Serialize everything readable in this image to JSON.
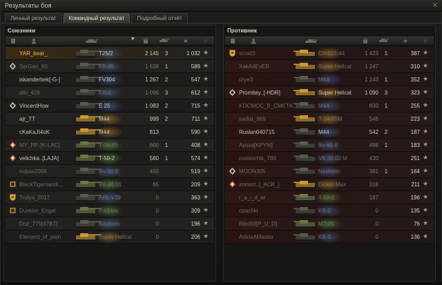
{
  "window": {
    "title": "Результаты боя",
    "close_glyph": "✕"
  },
  "tabs": [
    {
      "label": "Личный результат",
      "active": false
    },
    {
      "label": "Командный результат",
      "active": true
    },
    {
      "label": "Подробный отчёт",
      "active": false
    }
  ],
  "allies": {
    "title": "Союзники",
    "rows": [
      {
        "name": "YAR_bear_",
        "vehicle": "T25/2",
        "damage": "2 145",
        "kills": "3",
        "xp": "1 032",
        "self": true,
        "dead": false,
        "badge": "none",
        "vehicle_class": "blue"
      },
      {
        "name": "SerGan_80",
        "vehicle": "KB-85",
        "damage": "1 638",
        "kills": "1",
        "xp": "589",
        "self": false,
        "dead": true,
        "badge": "clan",
        "vehicle_class": "blue"
      },
      {
        "name": "iskanderbek[-G-]",
        "vehicle": "FV304",
        "damage": "1 267",
        "kills": "2",
        "xp": "547",
        "self": false,
        "dead": false,
        "badge": "none",
        "vehicle_class": "blue"
      },
      {
        "name": "diki_428",
        "vehicle": "KB-2",
        "damage": "1 096",
        "kills": "3",
        "xp": "612",
        "self": false,
        "dead": true,
        "badge": "none",
        "vehicle_class": "blue"
      },
      {
        "name": "VincentHow",
        "vehicle": "E 25",
        "damage": "1 083",
        "kills": "2",
        "xp": "715",
        "self": false,
        "dead": false,
        "badge": "clan",
        "vehicle_class": "blue"
      },
      {
        "name": "ajr_TT",
        "vehicle": "M44",
        "damage": "999",
        "kills": "2",
        "xp": "711",
        "self": false,
        "dead": false,
        "badge": "none",
        "vehicle_class": "gold"
      },
      {
        "name": "cKaKaJI4oK",
        "vehicle": "M44",
        "damage": "813",
        "kills": "",
        "xp": "590",
        "self": false,
        "dead": false,
        "badge": "none",
        "vehicle_class": "gold"
      },
      {
        "name": "MY_PP..[K-LAC]",
        "vehicle": "T-34-85",
        "damage": "600",
        "kills": "1",
        "xp": "408",
        "self": false,
        "dead": true,
        "badge": "rank",
        "vehicle_class": "green"
      },
      {
        "name": "velichka..[LAJA]",
        "vehicle": "T-50-2",
        "damage": "580",
        "kills": "1",
        "xp": "574",
        "self": false,
        "dead": false,
        "badge": "rank",
        "vehicle_class": "green"
      },
      {
        "name": "nubas2009",
        "vehicle": "Ikv 90 B",
        "damage": "450",
        "kills": "",
        "xp": "519",
        "self": false,
        "dead": true,
        "badge": "none",
        "vehicle_class": "blue"
      },
      {
        "name": "BlackTigemandi...",
        "vehicle": "VK 28.01",
        "damage": "65",
        "kills": "",
        "xp": "209",
        "self": false,
        "dead": true,
        "badge": "clan2",
        "vehicle_class": "green"
      },
      {
        "name": "Trulya_2017",
        "vehicle": "ARL V39",
        "damage": "0",
        "kills": "",
        "xp": "363",
        "self": false,
        "dead": true,
        "badge": "shield",
        "vehicle_class": "blue"
      },
      {
        "name": "Dunkler_Engel",
        "vehicle": "P.43 bis",
        "damage": "0",
        "kills": "",
        "xp": "309",
        "self": false,
        "dead": true,
        "badge": "clan2",
        "vehicle_class": "green"
      },
      {
        "name": "Doz_775[47BT]",
        "vehicle": "Nashorn",
        "damage": "0",
        "kills": "",
        "xp": "196",
        "self": false,
        "dead": true,
        "badge": "none",
        "vehicle_class": "blue"
      },
      {
        "name": "Element_of_pain",
        "vehicle": "Super Hellcat",
        "damage": "0",
        "kills": "",
        "xp": "206",
        "self": false,
        "dead": true,
        "badge": "none",
        "vehicle_class": "gold"
      }
    ]
  },
  "enemies": {
    "title": "Противник",
    "rows": [
      {
        "name": "scratt3",
        "vehicle": "СУ-122-44",
        "damage": "1 423",
        "kills": "1",
        "xp": "387",
        "dead": true,
        "badge": "shield",
        "vehicle_class": "gold"
      },
      {
        "name": "XakA4EvER",
        "vehicle": "Super Hellcat",
        "damage": "1 247",
        "kills": "",
        "xp": "310",
        "dead": true,
        "badge": "none",
        "vehicle_class": "gold"
      },
      {
        "name": "orye3",
        "vehicle": "M44",
        "damage": "1 143",
        "kills": "1",
        "xp": "352",
        "dead": true,
        "badge": "none",
        "vehicle_class": "blue"
      },
      {
        "name": "Promitey..[-HDR]",
        "vehicle": "Super Hellcat",
        "damage": "1 090",
        "kills": "3",
        "xp": "323",
        "dead": false,
        "badge": "clan",
        "vehicle_class": "gold"
      },
      {
        "name": "KOCMOC_B_CMETA..",
        "vehicle": "M44",
        "damage": "830",
        "kills": "1",
        "xp": "255",
        "dead": true,
        "badge": "none",
        "vehicle_class": "blue"
      },
      {
        "name": "sadist_669",
        "vehicle": "T-34-85M",
        "damage": "546",
        "kills": "",
        "xp": "223",
        "dead": true,
        "badge": "none",
        "vehicle_class": "gold"
      },
      {
        "name": "Ruslan040715",
        "vehicle": "M44",
        "damage": "542",
        "kills": "2",
        "xp": "187",
        "dead": false,
        "badge": "none",
        "vehicle_class": "blue"
      },
      {
        "name": "Apsss[KPYM]",
        "vehicle": "Ikv 65 II",
        "damage": "488",
        "kills": "1",
        "xp": "183",
        "dead": true,
        "badge": "none",
        "vehicle_class": "blue"
      },
      {
        "name": "ruslanchik_780",
        "vehicle": "VK 30.02 M",
        "damage": "430",
        "kills": "",
        "xp": "251",
        "dead": true,
        "badge": "none",
        "vehicle_class": "blue"
      },
      {
        "name": "MOON305",
        "vehicle": "Nashorn",
        "damage": "381",
        "kills": "1",
        "xp": "164",
        "dead": true,
        "badge": "clan",
        "vehicle_class": "blue"
      },
      {
        "name": "immort..[_ACK_]",
        "vehicle": "Dicker Max",
        "damage": "318",
        "kills": "",
        "xp": "211",
        "dead": true,
        "badge": "rank",
        "vehicle_class": "gold"
      },
      {
        "name": "r_a_i_d_er",
        "vehicle": "T-50-2",
        "damage": "187",
        "kills": "",
        "xp": "196",
        "dead": true,
        "badge": "none",
        "vehicle_class": "green"
      },
      {
        "name": "opachki",
        "vehicle": "KB-2",
        "damage": "0",
        "kills": "",
        "xp": "135",
        "dead": true,
        "badge": "none",
        "vehicle_class": "blue"
      },
      {
        "name": "Riko59[P_U_D]",
        "vehicle": "MT-25",
        "damage": "0",
        "kills": "",
        "xp": "76",
        "dead": true,
        "badge": "none",
        "vehicle_class": "green"
      },
      {
        "name": "AntoxAMaster",
        "vehicle": "KB-3",
        "damage": "0",
        "kills": "",
        "xp": "136",
        "dead": true,
        "badge": "none",
        "vehicle_class": "blue"
      }
    ]
  },
  "columns": {
    "icons": [
      "player-icon",
      "vehicle-icon",
      "damage-icon",
      "kills-icon",
      "xp-icon",
      "star-icon"
    ],
    "sorted_column": "damage"
  },
  "colors": {
    "self_highlight": "#f0b84a",
    "ally_row": "#23221f",
    "enemy_row": "#2a1412",
    "star": "#9e9a8c"
  }
}
